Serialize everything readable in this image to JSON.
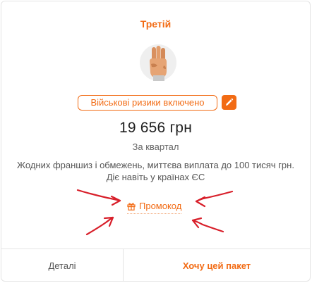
{
  "package": {
    "title": "Третій",
    "illustration_icon": "three-fingers-hand-icon",
    "badge_label": "Військові ризики включено",
    "edit_icon": "pencil-icon",
    "price": "19 656 грн",
    "period": "За квартал",
    "description": "Жодних франшиз і обмежень, миттєва виплата до 100 тисяч грн. Діє навіть у країнах ЄС"
  },
  "promo": {
    "icon": "gift-icon",
    "label": "Промокод"
  },
  "footer": {
    "details_label": "Деталі",
    "buy_label": "Хочу цей пакет"
  },
  "colors": {
    "accent": "#f26b14",
    "annotation": "#d81f2a",
    "border": "#e4e4e4",
    "text_dark": "#1f1f1f",
    "text_muted": "#555555"
  }
}
